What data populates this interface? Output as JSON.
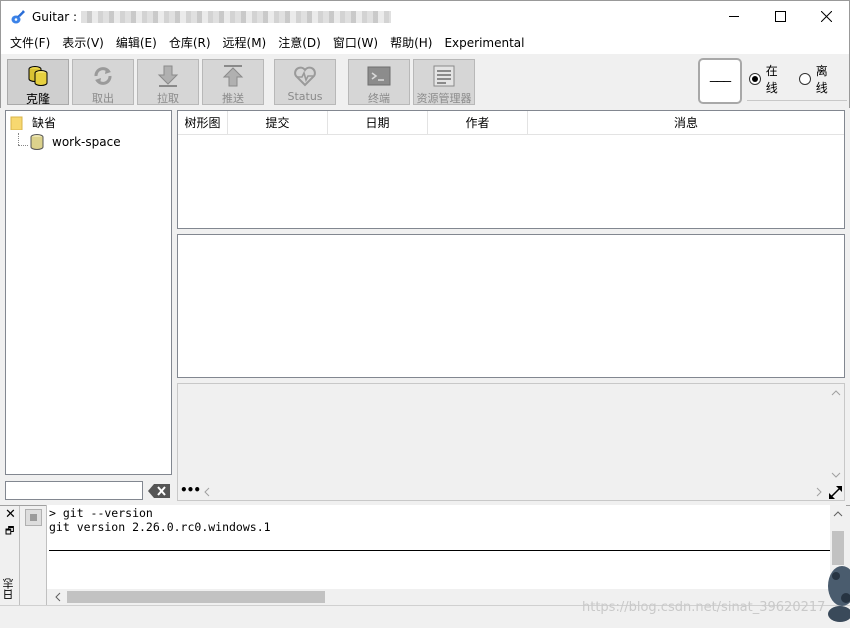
{
  "window": {
    "title_prefix": "Guitar : ",
    "app_icon": "guitar-icon",
    "controls": [
      "minimize-icon",
      "maximize-icon",
      "close-icon"
    ]
  },
  "menu": {
    "items": [
      "文件(F)",
      "表示(V)",
      "编辑(E)",
      "仓库(R)",
      "远程(M)",
      "注意(D)",
      "窗口(W)",
      "帮助(H)",
      "Experimental"
    ]
  },
  "toolbar": {
    "buttons": [
      {
        "label": "克隆",
        "icon": "clone-database-icon",
        "enabled": true
      },
      {
        "label": "取出",
        "icon": "fetch-refresh-icon",
        "enabled": false
      },
      {
        "label": "拉取",
        "icon": "pull-arrow-down-icon",
        "enabled": false
      },
      {
        "label": "推送",
        "icon": "push-arrow-up-icon",
        "enabled": false
      },
      {
        "label": "Status",
        "icon": "status-heart-icon",
        "enabled": false
      },
      {
        "label": "终端",
        "icon": "terminal-icon",
        "enabled": false
      },
      {
        "label": "资源管理器",
        "icon": "explorer-list-icon",
        "enabled": false
      }
    ],
    "status_display": "———",
    "mode_options": [
      {
        "label": "在线",
        "selected": true
      },
      {
        "label": "离线",
        "selected": false
      }
    ]
  },
  "tree": {
    "root": {
      "label": "缺省",
      "icon": "folder-icon"
    },
    "children": [
      {
        "label": "work-space",
        "icon": "repository-icon"
      }
    ],
    "filter_value": ""
  },
  "commits": {
    "columns": [
      "树形图",
      "提交",
      "日期",
      "作者",
      "消息"
    ],
    "rows": []
  },
  "diff": {
    "more_label": "•••"
  },
  "console": {
    "close_label": "✕",
    "restore_label": "🗗",
    "panel_label": "日志",
    "lines": [
      "> git --version",
      "git version 2.26.0.rc0.windows.1"
    ]
  },
  "watermark": "https://blog.csdn.net/sinat_39620217",
  "colors": {
    "panel_bg": "#f0f0f0",
    "border": "#828790",
    "disabled_text": "#8a8a8a"
  }
}
